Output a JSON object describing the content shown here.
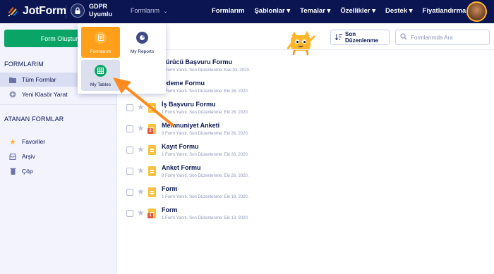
{
  "header": {
    "logo_text": "JotForm",
    "gdpr_line1": "GDPR",
    "gdpr_line2": "Uyumlu",
    "forms_dropdown": "Formlarım",
    "nav": [
      "Formlarım",
      "Şablonlar ▾",
      "Temalar ▾",
      "Özellikler ▾",
      "Destek ▾",
      "Fiyatlandırma"
    ]
  },
  "sidebar": {
    "create_button": "Form Oluştur",
    "section_forms": "FORMLARIM",
    "all_forms": "Tüm Formlar",
    "new_folder": "Yeni Klasör Yarat",
    "section_assigned": "ATANAN FORMLAR",
    "favorites": "Favoriler",
    "archive": "Arşiv",
    "trash": "Çöp"
  },
  "toolbar": {
    "sort_label": "Son Düzenlenme",
    "search_placeholder": "Formlarımda Ara"
  },
  "apps_menu": {
    "forms": "Formlarım",
    "reports": "My Reports",
    "tables": "My Tables"
  },
  "forms": [
    {
      "title": "Sürücü Başvuru Formu",
      "meta": "1 Form Yanıtı. Son Düzenlenme: Kas 03, 2020.",
      "badge": ""
    },
    {
      "title": "Ödeme Formu",
      "meta": "1 Form Yanıtı. Son Düzenlenme: Eki 26, 2020.",
      "badge": ""
    },
    {
      "title": "İş Başvuru Formu",
      "meta": "1 Form Yanıtı. Son Düzenlenme: Eki 26, 2020.",
      "badge": ""
    },
    {
      "title": "Memnuniyet Anketi",
      "meta": "3 Form Yanıtı. Son Düzenlenme: Eki 26, 2020.",
      "badge": "2"
    },
    {
      "title": "Kayıt Formu",
      "meta": "1 Form Yanıtı. Son Düzenlenme: Eki 26, 2020.",
      "badge": ""
    },
    {
      "title": "Anket Formu",
      "meta": "8 Form Yanıtı. Son Düzenlenme: Eki 26, 2020.",
      "badge": ""
    },
    {
      "title": "Form",
      "meta": "1 Form Yanıtı. Son Düzenlenme: Eki 19, 2020.",
      "badge": ""
    },
    {
      "title": "Form",
      "meta": "1 Form Yanıtı. Son Düzenlenme: Eki 13, 2020.",
      "badge": "1"
    }
  ],
  "colors": {
    "topbar": "#0a1551",
    "create_button": "#0aa566",
    "forms_tile": "#ff9f1a",
    "arrow": "#ff8a1f",
    "form_icon": "#f9c13d"
  }
}
